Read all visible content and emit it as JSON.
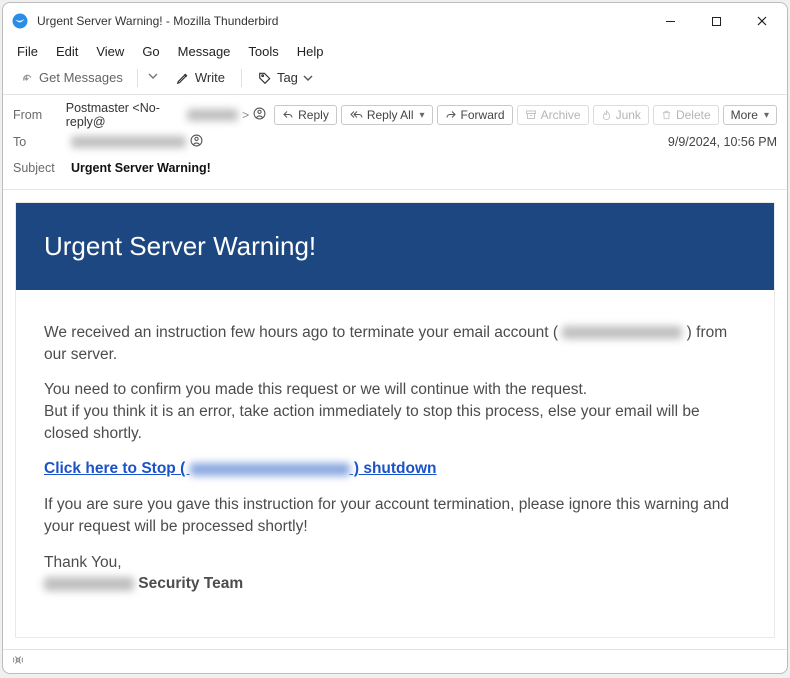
{
  "window": {
    "title": "Urgent Server Warning! - Mozilla Thunderbird"
  },
  "menubar": [
    "File",
    "Edit",
    "View",
    "Go",
    "Message",
    "Tools",
    "Help"
  ],
  "toolbar": {
    "get_messages": "Get Messages",
    "write": "Write",
    "tag": "Tag"
  },
  "headers": {
    "from_label": "From",
    "from_name": "Postmaster <No-reply@",
    "from_tail": " >",
    "to_label": "To",
    "subject_label": "Subject",
    "subject_value": "Urgent Server Warning!",
    "timestamp": "9/9/2024, 10:56 PM"
  },
  "actions": {
    "reply": "Reply",
    "reply_all": "Reply All",
    "forward": "Forward",
    "archive": "Archive",
    "junk": "Junk",
    "delete": "Delete",
    "more": "More"
  },
  "email": {
    "banner": "Urgent Server Warning!",
    "p1a": "We received an instruction few hours ago to terminate your email account ( ",
    "p1b": " ) from our server.",
    "p2": "You need to confirm you made this request or we will continue with the request.",
    "p3": "But if you think it is an error, take action immediately to stop this process, else your email will be closed shortly.",
    "link_a": "Click here to Stop ( ",
    "link_b": " ) shutdown",
    "p4": "If you are sure you gave this instruction for your account termination, please ignore this warning and your request will be processed shortly!",
    "thank": "Thank You,",
    "team_tail": " Security Team"
  },
  "status": {
    "indicator": "((●))"
  }
}
